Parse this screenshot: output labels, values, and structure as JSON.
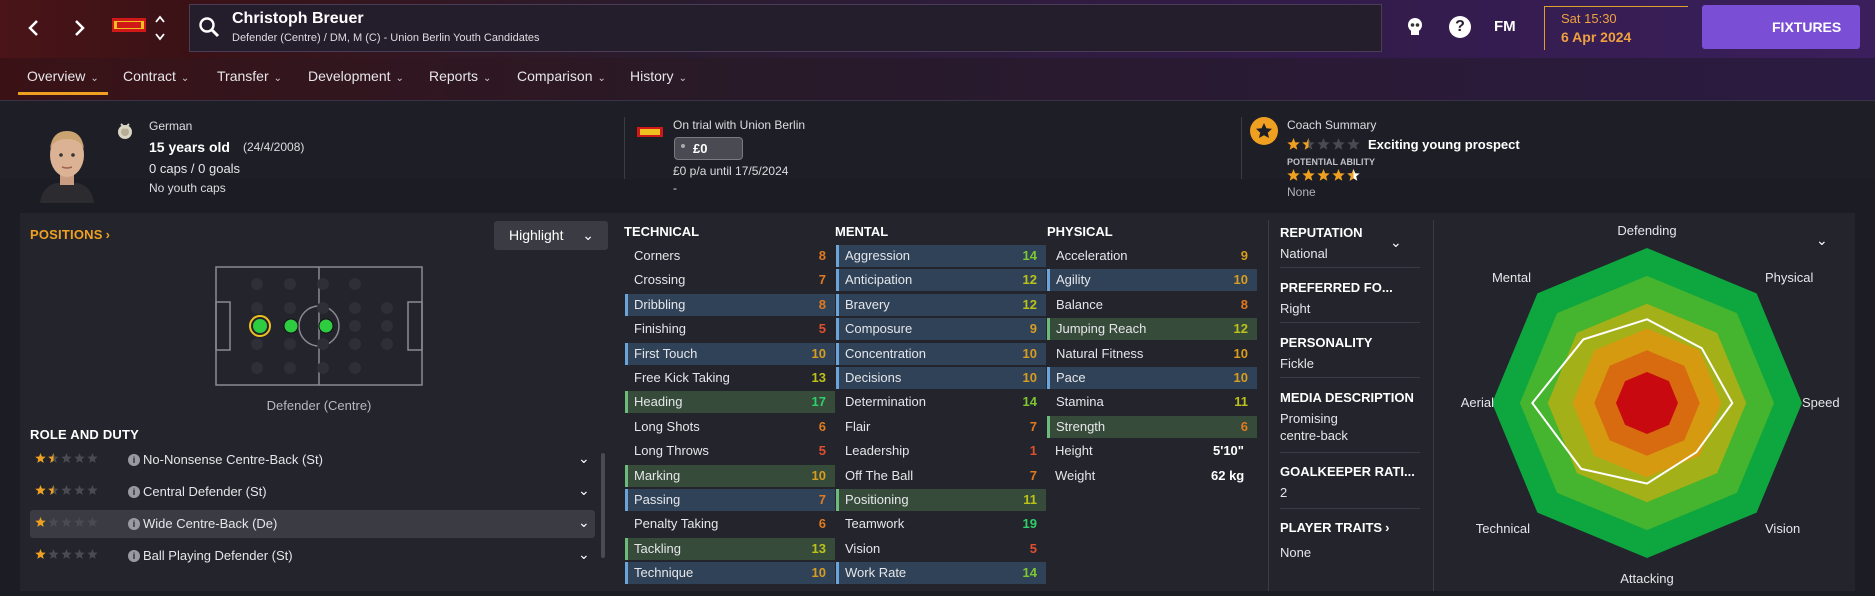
{
  "header": {
    "player_name": "Christoph Breuer",
    "player_description": "Defender (Centre) / DM, M (C) - Union Berlin Youth Candidates",
    "date_day": "Sat 15:30",
    "date": "6 Apr 2024",
    "fm_label": "FM",
    "fixtures_label": "FIXTURES",
    "icons": [
      "back-arrow-icon",
      "forward-arrow-icon",
      "club-crest-icon",
      "search-icon",
      "skull-icon",
      "help-icon"
    ]
  },
  "tabs": [
    {
      "label": "Overview",
      "active": true
    },
    {
      "label": "Contract"
    },
    {
      "label": "Transfer"
    },
    {
      "label": "Development"
    },
    {
      "label": "Reports"
    },
    {
      "label": "Comparison"
    },
    {
      "label": "History"
    }
  ],
  "profile": {
    "nationality": "German",
    "age": "15 years old",
    "dob": "(24/4/2008)",
    "caps": "0 caps / 0 goals",
    "youth_caps": "No youth caps"
  },
  "contract": {
    "status": "On trial with Union Berlin",
    "value": "£0",
    "wage": "£0 p/a until 17/5/2024",
    "extra": "-"
  },
  "coach": {
    "title": "Coach Summary",
    "summary": "Exciting young prospect",
    "potential_label": "POTENTIAL ABILITY",
    "current_stars": 1.5,
    "potential_stars": 4.5,
    "none_label": "None"
  },
  "positions": {
    "title": "POSITIONS",
    "highlight_label": "Highlight",
    "position_caption": "Defender (Centre)"
  },
  "roles": {
    "title": "ROLE AND DUTY",
    "items": [
      {
        "label": "No-Nonsense Centre-Back (St)",
        "stars": 1.5
      },
      {
        "label": "Central Defender (St)",
        "stars": 1.5
      },
      {
        "label": "Wide Centre-Back (De)",
        "stars": 1,
        "selected": true
      },
      {
        "label": "Ball Playing Defender (St)",
        "stars": 1
      }
    ]
  },
  "attributes": {
    "technical_title": "TECHNICAL",
    "mental_title": "MENTAL",
    "physical_title": "PHYSICAL",
    "technical": [
      {
        "name": "Corners",
        "value": 8,
        "hl": ""
      },
      {
        "name": "Crossing",
        "value": 7,
        "hl": ""
      },
      {
        "name": "Dribbling",
        "value": 8,
        "hl": "blue"
      },
      {
        "name": "Finishing",
        "value": 5,
        "hl": ""
      },
      {
        "name": "First Touch",
        "value": 10,
        "hl": "blue"
      },
      {
        "name": "Free Kick Taking",
        "value": 13,
        "hl": ""
      },
      {
        "name": "Heading",
        "value": 17,
        "hl": "green"
      },
      {
        "name": "Long Shots",
        "value": 6,
        "hl": ""
      },
      {
        "name": "Long Throws",
        "value": 5,
        "hl": ""
      },
      {
        "name": "Marking",
        "value": 10,
        "hl": "green"
      },
      {
        "name": "Passing",
        "value": 7,
        "hl": "blue"
      },
      {
        "name": "Penalty Taking",
        "value": 6,
        "hl": ""
      },
      {
        "name": "Tackling",
        "value": 13,
        "hl": "green"
      },
      {
        "name": "Technique",
        "value": 10,
        "hl": "blue"
      }
    ],
    "mental": [
      {
        "name": "Aggression",
        "value": 14,
        "hl": "blue"
      },
      {
        "name": "Anticipation",
        "value": 12,
        "hl": "blue"
      },
      {
        "name": "Bravery",
        "value": 12,
        "hl": "blue"
      },
      {
        "name": "Composure",
        "value": 9,
        "hl": "blue"
      },
      {
        "name": "Concentration",
        "value": 10,
        "hl": "blue"
      },
      {
        "name": "Decisions",
        "value": 10,
        "hl": "blue"
      },
      {
        "name": "Determination",
        "value": 14,
        "hl": ""
      },
      {
        "name": "Flair",
        "value": 7,
        "hl": ""
      },
      {
        "name": "Leadership",
        "value": 1,
        "hl": ""
      },
      {
        "name": "Off The Ball",
        "value": 7,
        "hl": ""
      },
      {
        "name": "Positioning",
        "value": 11,
        "hl": "green"
      },
      {
        "name": "Teamwork",
        "value": 19,
        "hl": ""
      },
      {
        "name": "Vision",
        "value": 5,
        "hl": ""
      },
      {
        "name": "Work Rate",
        "value": 14,
        "hl": "blue"
      }
    ],
    "physical": [
      {
        "name": "Acceleration",
        "value": 9,
        "hl": ""
      },
      {
        "name": "Agility",
        "value": 10,
        "hl": "blue"
      },
      {
        "name": "Balance",
        "value": 8,
        "hl": ""
      },
      {
        "name": "Jumping Reach",
        "value": 12,
        "hl": "green"
      },
      {
        "name": "Natural Fitness",
        "value": 10,
        "hl": ""
      },
      {
        "name": "Pace",
        "value": 10,
        "hl": "blue"
      },
      {
        "name": "Stamina",
        "value": 11,
        "hl": ""
      },
      {
        "name": "Strength",
        "value": 6,
        "hl": "green"
      }
    ],
    "height_label": "Height",
    "height_value": "5'10\"",
    "weight_label": "Weight",
    "weight_value": "62 kg"
  },
  "sidebar": {
    "reputation_label": "REPUTATION",
    "reputation_value": "National",
    "foot_label": "PREFERRED FO...",
    "foot_value": "Right",
    "personality_label": "PERSONALITY",
    "personality_value": "Fickle",
    "media_label": "MEDIA DESCRIPTION",
    "media_value_1": "Promising",
    "media_value_2": "centre-back",
    "gk_label": "GOALKEEPER RATI...",
    "gk_value": "2",
    "traits_label": "PLAYER TRAITS",
    "traits_value": "None"
  },
  "radar": {
    "labels": [
      "Defending",
      "Physical",
      "Speed",
      "Vision",
      "Attacking",
      "Technical",
      "Aerial",
      "Mental"
    ],
    "player_polygon": [
      0.54,
      0.5,
      0.55,
      0.45,
      0.52,
      0.6,
      0.74,
      0.58
    ]
  }
}
